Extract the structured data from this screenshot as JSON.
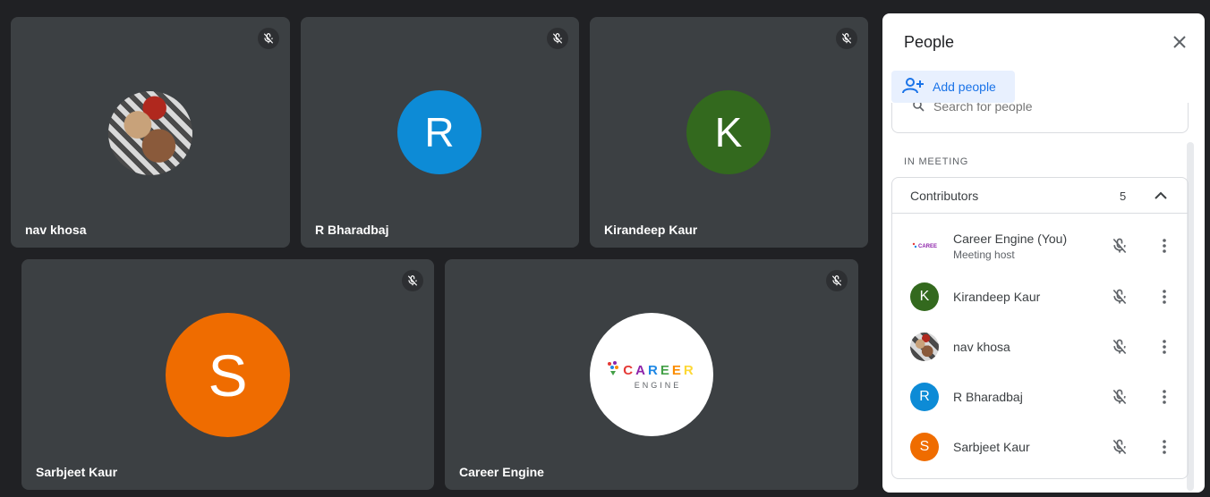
{
  "tiles": [
    {
      "name": "nav khosa",
      "avatar_type": "photo"
    },
    {
      "name": "R Bharadbaj",
      "initial": "R",
      "color": "#0d8bd6"
    },
    {
      "name": "Kirandeep Kaur",
      "initial": "K",
      "color": "#33691e"
    },
    {
      "name": "Sarbjeet Kaur",
      "initial": "S",
      "color": "#ef6c00"
    },
    {
      "name": "Career Engine",
      "avatar_type": "logo"
    }
  ],
  "logo": {
    "word": "CAREER",
    "sub": "ENGINE"
  },
  "panel": {
    "title": "People",
    "add_people_label": "Add people",
    "search_placeholder": "Search for people",
    "section_label": "IN MEETING",
    "contributors_label": "Contributors",
    "contributors_count": "5",
    "people": [
      {
        "name": "Career Engine (You)",
        "sub": "Meeting host",
        "avatar_type": "logo"
      },
      {
        "name": "Kirandeep Kaur",
        "initial": "K",
        "color": "#33691e"
      },
      {
        "name": "nav khosa",
        "avatar_type": "photo"
      },
      {
        "name": "R Bharadbaj",
        "initial": "R",
        "color": "#0d8bd6"
      },
      {
        "name": "Sarbjeet Kaur",
        "initial": "S",
        "color": "#ef6c00"
      }
    ]
  },
  "icons": {
    "mute": "mic-off-icon",
    "close": "close-icon",
    "add": "person-add-icon",
    "more": "more-vert-icon",
    "collapse": "chevron-up-icon",
    "search": "search-icon"
  }
}
